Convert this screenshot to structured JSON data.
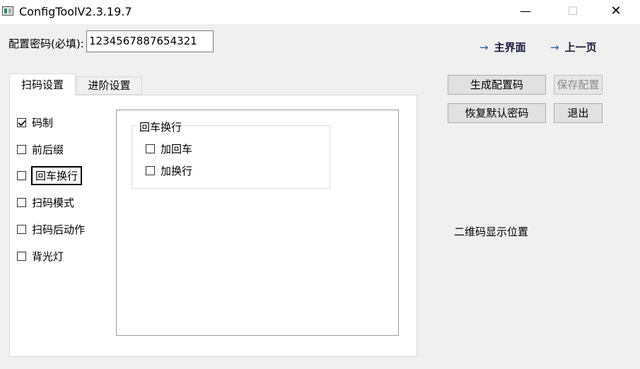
{
  "window": {
    "title": "ConfigToolV2.3.19.7",
    "minimize_glyph": "—",
    "maximize_glyph": "☐",
    "close_glyph": "✕"
  },
  "password": {
    "label": "配置密码(必填):",
    "value": "1234567887654321"
  },
  "nav": {
    "main_label": "主界面",
    "prev_label": "上一页",
    "arrow_glyph": "→"
  },
  "tabs": [
    {
      "label": "扫码设置",
      "active": true
    },
    {
      "label": "进阶设置",
      "active": false
    }
  ],
  "options": [
    {
      "label": "码制",
      "checked": true
    },
    {
      "label": "前后缀",
      "checked": false
    },
    {
      "label": "回车换行",
      "checked": false,
      "focused": true
    },
    {
      "label": "扫码模式",
      "checked": false
    },
    {
      "label": "扫码后动作",
      "checked": false
    },
    {
      "label": "背光灯",
      "checked": false
    }
  ],
  "group": {
    "title": "回车换行",
    "items": [
      {
        "label": "加回车",
        "checked": false
      },
      {
        "label": "加换行",
        "checked": false
      }
    ]
  },
  "buttons": {
    "generate": "生成配置码",
    "save": "保存配置",
    "restore": "恢复默认密码",
    "exit": "退出"
  },
  "qr_placeholder": "二维码显示位置"
}
